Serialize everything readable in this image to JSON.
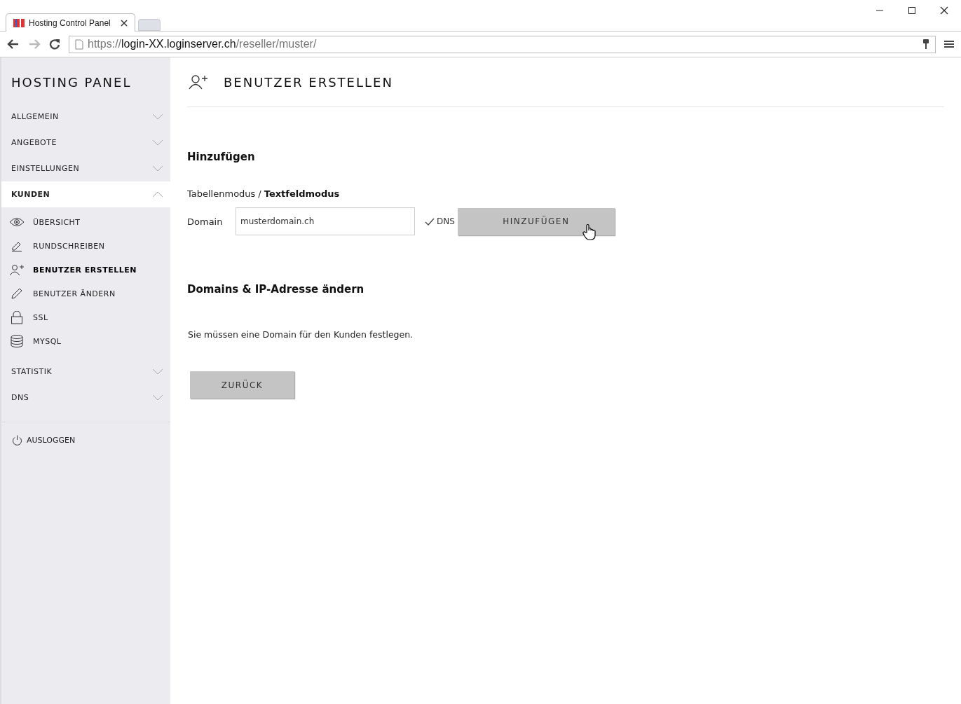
{
  "browser": {
    "tab_title": "Hosting Control Panel",
    "url": {
      "scheme": "https://",
      "host": "login-XX.loginserver.ch",
      "path": "/reseller/muster/"
    }
  },
  "sidebar": {
    "title": "HOSTING PANEL",
    "items": [
      {
        "label": "ALLGEMEIN",
        "expanded": false
      },
      {
        "label": "ANGEBOTE",
        "expanded": false
      },
      {
        "label": "EINSTELLUNGEN",
        "expanded": false
      },
      {
        "label": "KUNDEN",
        "expanded": true,
        "children": [
          {
            "label": "ÜBERSICHT",
            "selected": false
          },
          {
            "label": "RUNDSCHREIBEN",
            "selected": false
          },
          {
            "label": "BENUTZER ERSTELLEN",
            "selected": true
          },
          {
            "label": "BENUTZER ÄNDERN",
            "selected": false
          },
          {
            "label": "SSL",
            "selected": false
          },
          {
            "label": "MYSQL",
            "selected": false
          }
        ]
      },
      {
        "label": "STATISTIK",
        "expanded": false
      },
      {
        "label": "DNS",
        "expanded": false
      }
    ],
    "logout": "AUSLOGGEN"
  },
  "page": {
    "title": "BENUTZER ERSTELLEN",
    "section_add": "Hinzufügen",
    "modes": [
      {
        "label": "Tabellenmodus",
        "selected": false
      },
      {
        "label": "Textfeldmodus",
        "selected": true
      }
    ],
    "mode_separator": "/",
    "domain_label": "Domain",
    "domain_value": "musterdomain.ch",
    "dns": {
      "label": "DNS",
      "checked": true
    },
    "add_button": "HINZUFÜGEN",
    "section_domains": "Domains & IP-Adresse ändern",
    "message": "Sie müssen eine Domain für den Kunden festlegen.",
    "back_button": "ZURÜCK"
  }
}
